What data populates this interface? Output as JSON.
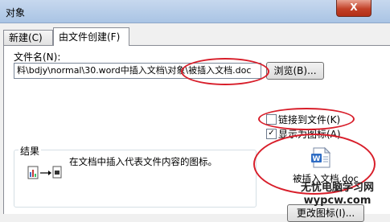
{
  "window": {
    "title": "对象",
    "close_label": "X"
  },
  "tabs": [
    {
      "label": "新建(C)"
    },
    {
      "label": "由文件创建(F)"
    }
  ],
  "file": {
    "label": "文件名(N):",
    "value": "料\\bdjy\\normal\\30.word中插入文档\\对象\\被插入文档.doc",
    "browse_label": "浏览(B)..."
  },
  "options": {
    "link_label": "链接到文件(K)",
    "link_checked": false,
    "display_icon_label": "显示为图标(A)",
    "display_icon_checked": true
  },
  "result": {
    "title": "结果",
    "text": "在文档中插入代表文件内容的图标。"
  },
  "icon_preview": {
    "caption": "被插入文档.doc",
    "change_icon_label": "更改图标(I)...",
    "icon": "word-document-icon"
  },
  "watermark": {
    "line1": "无忧电脑学习网",
    "line2": "wypcw.com"
  },
  "colors": {
    "highlight_circle": "#d81e2a",
    "titlebar": "#b8cfe9"
  }
}
